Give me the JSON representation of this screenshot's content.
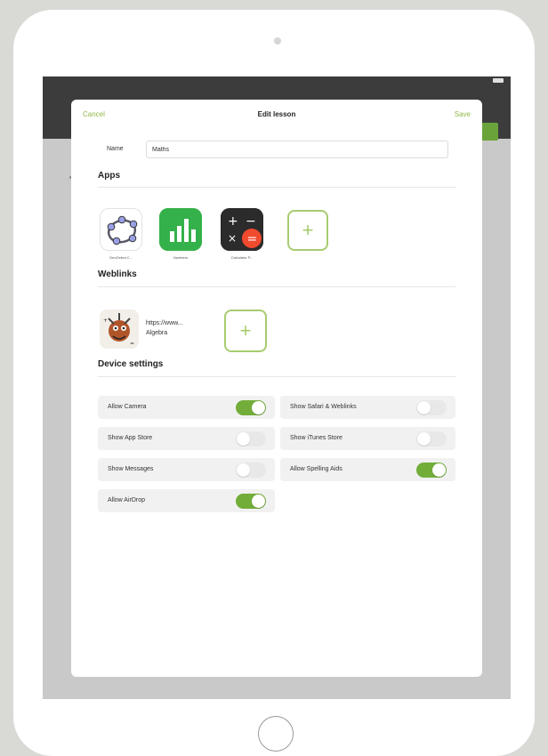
{
  "modal": {
    "cancel_label": "Cancel",
    "title": "Edit lesson",
    "save_label": "Save"
  },
  "name_field": {
    "label": "Name",
    "value": "Maths"
  },
  "apps": {
    "section_title": "Apps",
    "items": [
      {
        "label": "GeoGebra C...",
        "icon": "geogebra-icon"
      },
      {
        "label": "Numbers",
        "icon": "numbers-icon"
      },
      {
        "label": "Calculator P...",
        "icon": "calculator-icon"
      }
    ],
    "add_icon": "+"
  },
  "weblinks": {
    "section_title": "Weblinks",
    "items": [
      {
        "url": "https://www...",
        "title": "Algebra",
        "icon": "algebra-thumbnail"
      }
    ],
    "add_icon": "+"
  },
  "device_settings": {
    "section_title": "Device settings",
    "left": [
      {
        "label": "Allow Camera",
        "on": true
      },
      {
        "label": "Show App Store",
        "on": false
      },
      {
        "label": "Show Messages",
        "on": false
      },
      {
        "label": "Allow AirDrop",
        "on": true
      }
    ],
    "right": [
      {
        "label": "Show Safari & Weblinks",
        "on": false
      },
      {
        "label": "Show iTunes Store",
        "on": false
      },
      {
        "label": "Allow Spelling Aids",
        "on": true
      }
    ]
  },
  "colors": {
    "accent": "#8fb84a",
    "toggle_on": "#72ad3a",
    "toggle_off": "#e8e8e8",
    "add_border": "#a7cc6f"
  }
}
